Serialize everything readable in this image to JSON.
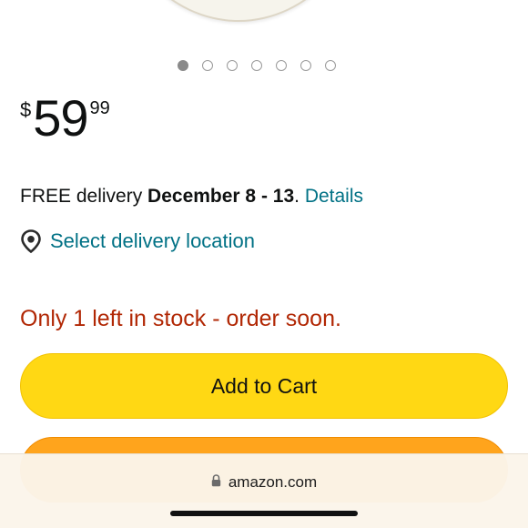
{
  "carousel": {
    "dot_count": 7,
    "active_index": 0
  },
  "price": {
    "symbol": "$",
    "whole": "59",
    "fraction": "99"
  },
  "delivery": {
    "prefix": "FREE delivery ",
    "dates": "December 8 - 13",
    "suffix": ". ",
    "details_link": "Details"
  },
  "location": {
    "icon": "location-pin-icon",
    "label": "Select delivery location"
  },
  "stock": {
    "message": "Only 1 left in stock - order soon."
  },
  "buttons": {
    "add_to_cart": "Add to Cart",
    "add_to_cart_color": "#FFD814",
    "buy_now_color": "#FFA41C"
  },
  "browser": {
    "lock_icon": "lock-icon",
    "url": "amazon.com"
  },
  "colors": {
    "link": "#007185",
    "stock_warning": "#B12704"
  }
}
